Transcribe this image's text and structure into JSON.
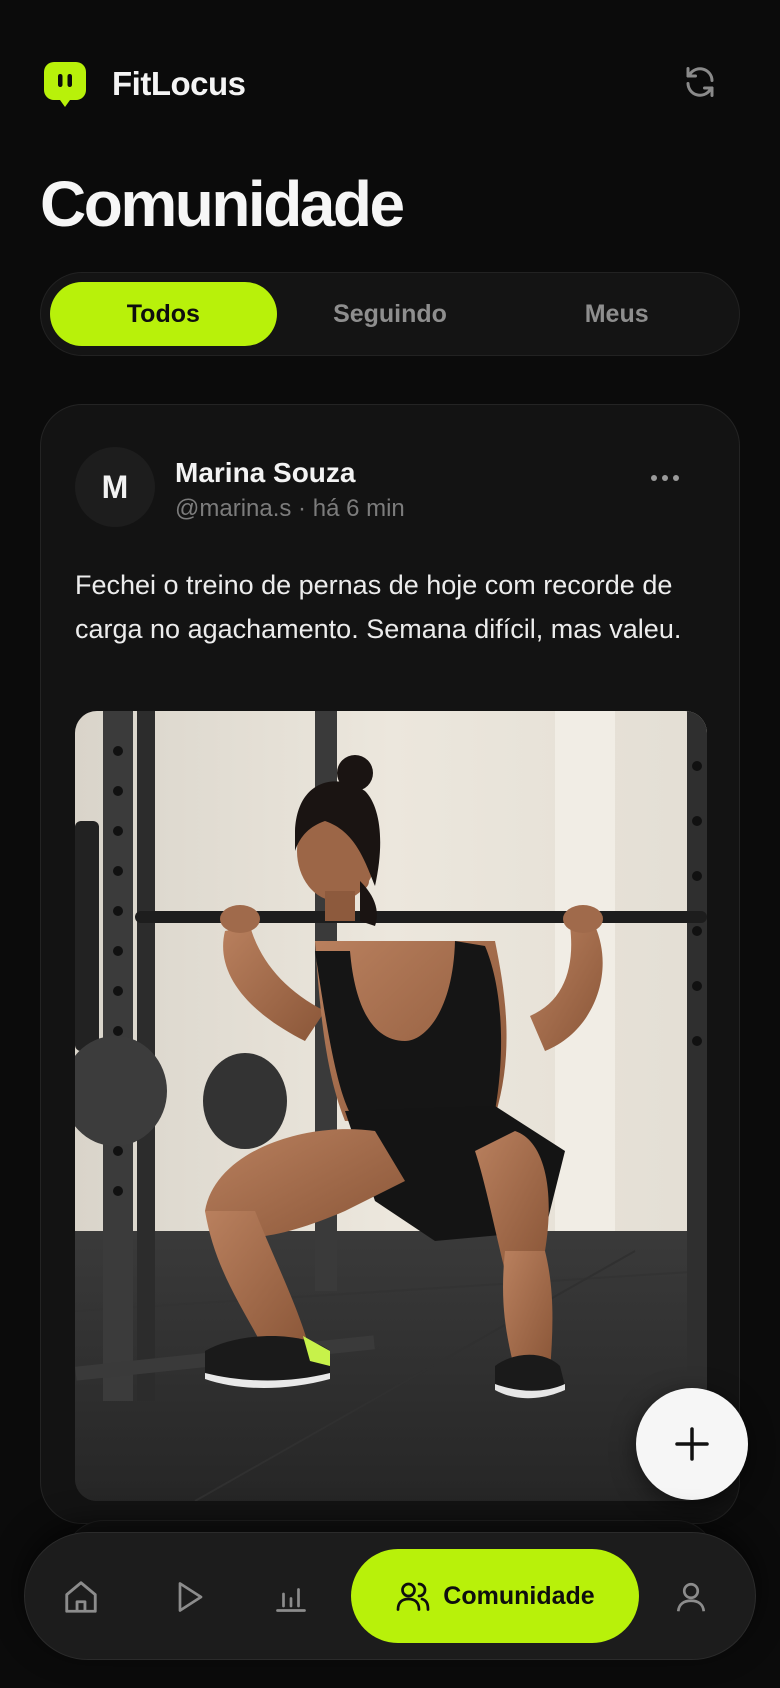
{
  "app": {
    "name": "FitLocus"
  },
  "page": {
    "title": "Comunidade"
  },
  "tabs": [
    {
      "label": "Todos",
      "active": true
    },
    {
      "label": "Seguindo",
      "active": false
    },
    {
      "label": "Meus",
      "active": false
    }
  ],
  "post": {
    "avatar_initial": "M",
    "author": "Marina Souza",
    "meta": "@marina.s · há 6 min",
    "text": "Fechei o treino de pernas de hoje com recorde de carga no agachamento. Semana difícil, mas valeu.",
    "image_icon": "photo-woman-barbell-squat"
  },
  "fab": {
    "icon": "plus-icon"
  },
  "bottom_nav": {
    "items": [
      {
        "icon": "home-icon"
      },
      {
        "icon": "play-icon"
      },
      {
        "icon": "bar-chart-icon"
      },
      {
        "icon": "users-icon",
        "label": "Comunidade",
        "active": true
      },
      {
        "icon": "user-icon"
      }
    ]
  },
  "colors": {
    "accent": "#b8f10a",
    "background": "#0b0b0b",
    "card": "#131313",
    "muted": "#8e8e8e"
  }
}
